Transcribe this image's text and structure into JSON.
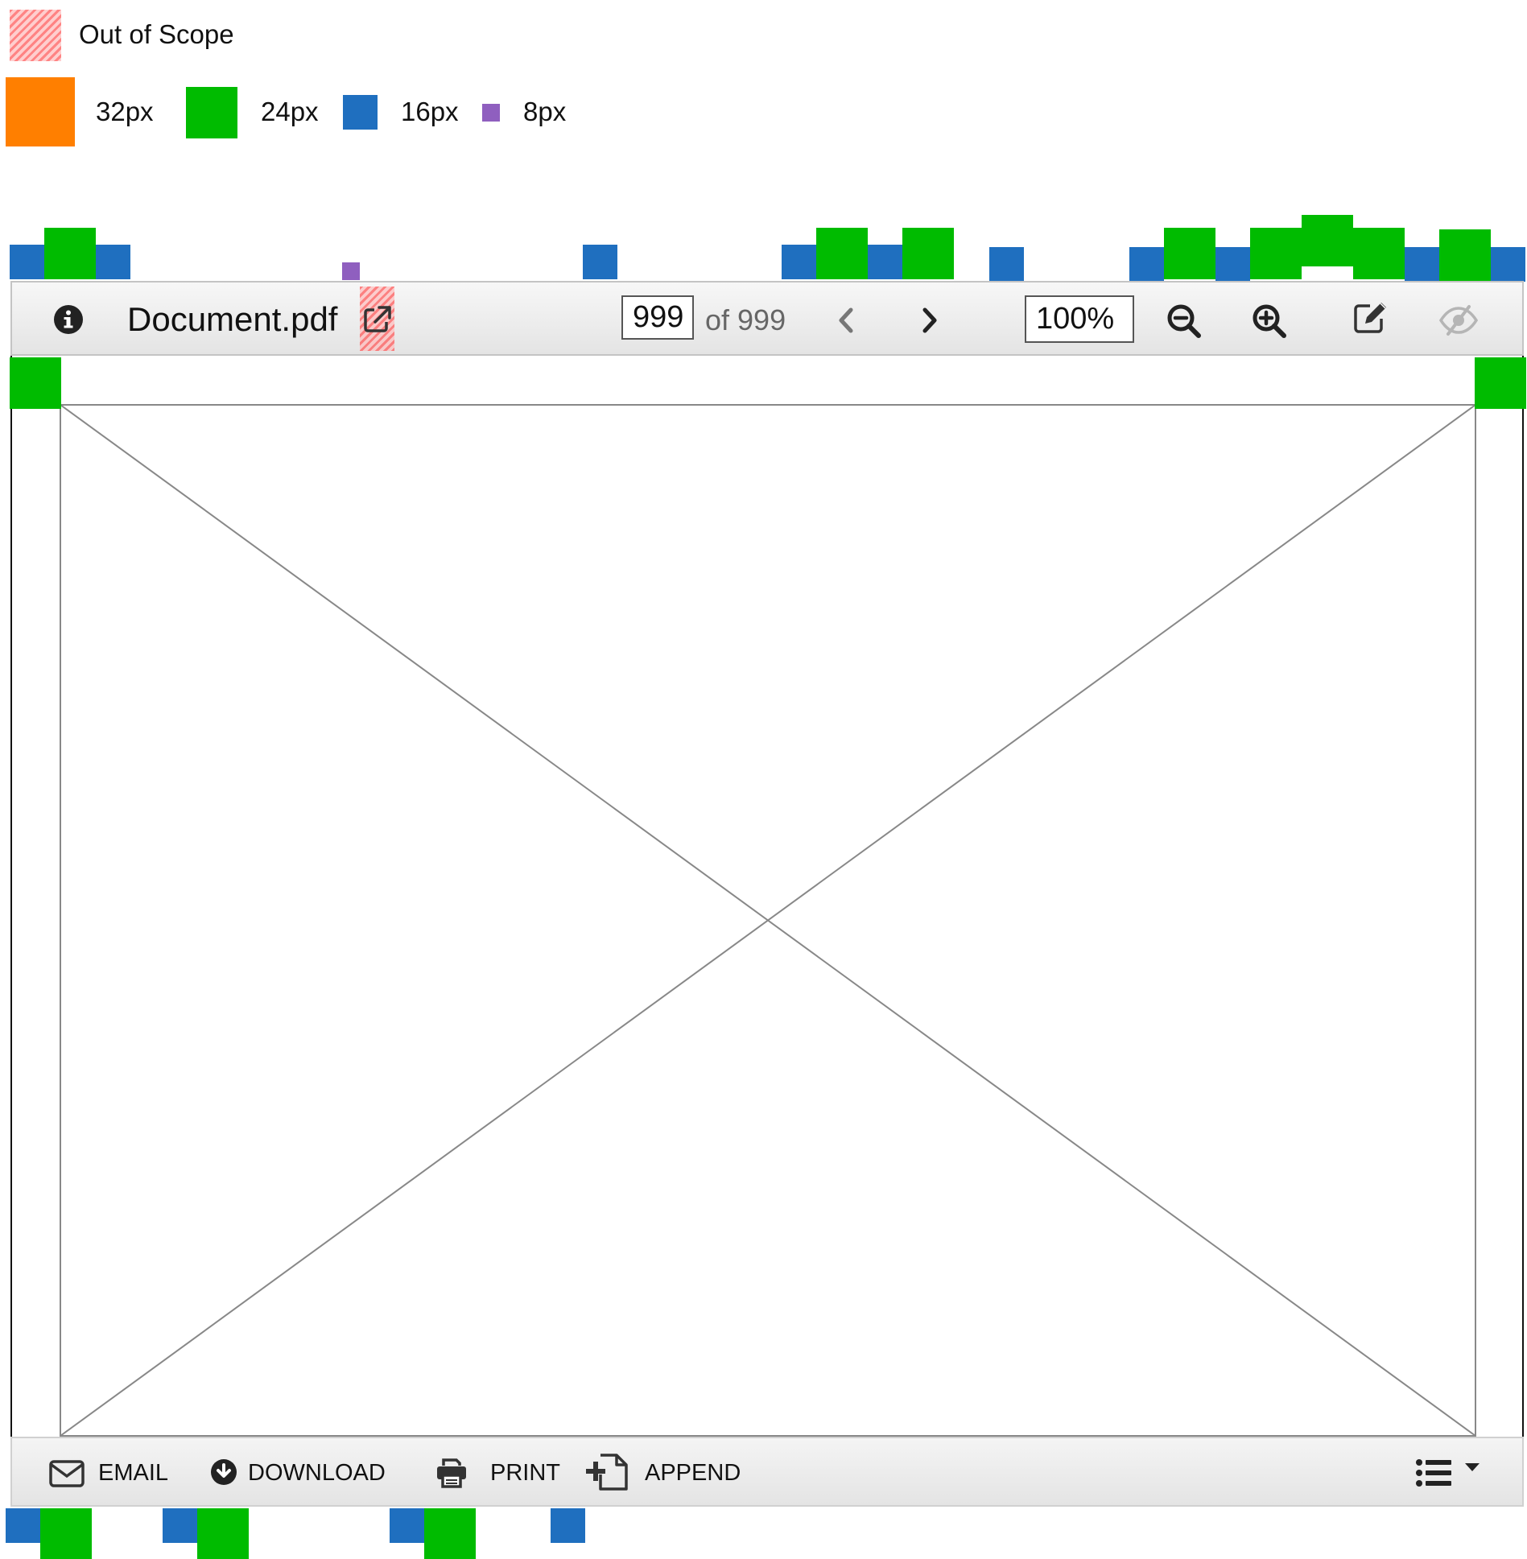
{
  "legend": {
    "out_of_scope_label": "Out of Scope",
    "sizes": [
      {
        "label": "32px",
        "color": "#ff7f00"
      },
      {
        "label": "24px",
        "color": "#00bb00"
      },
      {
        "label": "16px",
        "color": "#1f6fbf"
      },
      {
        "label": "8px",
        "color": "#8f5fbf"
      }
    ]
  },
  "toolbar": {
    "info_icon": "info-circle-icon",
    "document_title": "Document.pdf",
    "open_external_icon": "external-link-icon",
    "page_input_value": "999",
    "page_total_label": "of 999",
    "prev_icon": "chevron-left-icon",
    "next_icon": "chevron-right-icon",
    "zoom_input_value": "100%",
    "zoom_out_icon": "zoom-out-icon",
    "zoom_in_icon": "zoom-in-icon",
    "annotate_icon": "edit-icon",
    "hide_icon": "eye-slash-icon"
  },
  "actions": {
    "email_label": "EMAIL",
    "download_label": "DOWNLOAD",
    "print_label": "PRINT",
    "append_label": "APPEND",
    "more_icon": "list-dropdown-icon"
  },
  "colors": {
    "accent_orange": "#ff7f00",
    "accent_green": "#00bb00",
    "accent_blue": "#1f6fbf",
    "accent_purple": "#8f5fbf",
    "icon_dark": "#333333",
    "icon_disabled": "#b5b5b5"
  }
}
